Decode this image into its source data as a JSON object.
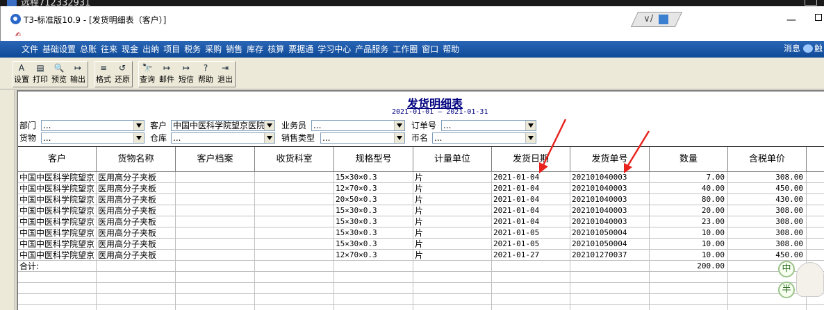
{
  "remote": {
    "title": "远程712332931"
  },
  "window": {
    "title": "T3-标准版10.9 - [发货明细表（客户）]",
    "minimize": "—"
  },
  "menubar": {
    "items": [
      "文件",
      "基础设置",
      "总账",
      "往来",
      "现金",
      "出纳",
      "项目",
      "税务",
      "采购",
      "销售",
      "库存",
      "核算",
      "票据通",
      "学习中心",
      "产品服务",
      "工作圈",
      "窗口",
      "帮助"
    ],
    "news": "消息",
    "news_more": "触"
  },
  "toolbar": {
    "buttons": [
      {
        "label": "设置",
        "icon": "A"
      },
      {
        "label": "打印",
        "icon": "▤"
      },
      {
        "label": "预览",
        "icon": "🔍"
      },
      {
        "label": "输出",
        "icon": "↦"
      },
      {
        "label": "格式",
        "icon": "≡"
      },
      {
        "label": "还原",
        "icon": "↺"
      },
      {
        "label": "查询",
        "icon": "🔭"
      },
      {
        "label": "邮件",
        "icon": "↦"
      },
      {
        "label": "短信",
        "icon": "↦"
      },
      {
        "label": "帮助",
        "icon": "?"
      },
      {
        "label": "退出",
        "icon": "⇥"
      }
    ]
  },
  "report": {
    "title": "发货明细表",
    "date_range": "2021-01-01 — 2021-01-31",
    "filters": {
      "dept": {
        "label": "部门",
        "value": "..."
      },
      "customer": {
        "label": "客户",
        "value": "中国中医科学院望京医院"
      },
      "salesman": {
        "label": "业务员",
        "value": "..."
      },
      "order_no": {
        "label": "订单号",
        "value": "..."
      },
      "goods": {
        "label": "货物",
        "value": "..."
      },
      "warehouse": {
        "label": "仓库",
        "value": "..."
      },
      "sales_type": {
        "label": "销售类型",
        "value": "..."
      },
      "currency": {
        "label": "币名",
        "value": "..."
      }
    },
    "columns": [
      "客户",
      "货物名称",
      "客户档案",
      "收货科室",
      "规格型号",
      "计量单位",
      "发货日期",
      "发货单号",
      "数量",
      "含税单价"
    ],
    "rows": [
      {
        "customer": "中国中医科学院望京",
        "goods": "医用高分子夹板",
        "profile": "",
        "dept": "",
        "spec": "15×30×0.3",
        "unit": "片",
        "date": "2021-01-04",
        "no": "202101040003",
        "qty": "7.00",
        "price": "308.00"
      },
      {
        "customer": "中国中医科学院望京",
        "goods": "医用高分子夹板",
        "profile": "",
        "dept": "",
        "spec": "12×70×0.3",
        "unit": "片",
        "date": "2021-01-04",
        "no": "202101040003",
        "qty": "40.00",
        "price": "450.00"
      },
      {
        "customer": "中国中医科学院望京",
        "goods": "医用高分子夹板",
        "profile": "",
        "dept": "",
        "spec": "20×50×0.3",
        "unit": "片",
        "date": "2021-01-04",
        "no": "202101040003",
        "qty": "80.00",
        "price": "430.00"
      },
      {
        "customer": "中国中医科学院望京",
        "goods": "医用高分子夹板",
        "profile": "",
        "dept": "",
        "spec": "15×30×0.3",
        "unit": "片",
        "date": "2021-01-04",
        "no": "202101040003",
        "qty": "20.00",
        "price": "308.00"
      },
      {
        "customer": "中国中医科学院望京",
        "goods": "医用高分子夹板",
        "profile": "",
        "dept": "",
        "spec": "15×30×0.3",
        "unit": "片",
        "date": "2021-01-04",
        "no": "202101040003",
        "qty": "23.00",
        "price": "308.00"
      },
      {
        "customer": "中国中医科学院望京",
        "goods": "医用高分子夹板",
        "profile": "",
        "dept": "",
        "spec": "15×30×0.3",
        "unit": "片",
        "date": "2021-01-05",
        "no": "202101050004",
        "qty": "10.00",
        "price": "308.00"
      },
      {
        "customer": "中国中医科学院望京",
        "goods": "医用高分子夹板",
        "profile": "",
        "dept": "",
        "spec": "15×30×0.3",
        "unit": "片",
        "date": "2021-01-05",
        "no": "202101050004",
        "qty": "10.00",
        "price": "308.00"
      },
      {
        "customer": "中国中医科学院望京",
        "goods": "医用高分子夹板",
        "profile": "",
        "dept": "",
        "spec": "12×70×0.3",
        "unit": "片",
        "date": "2021-01-27",
        "no": "202101270037",
        "qty": "10.00",
        "price": "450.00"
      }
    ],
    "total": {
      "label": "合计:",
      "qty": "200.00"
    }
  },
  "mascot": {
    "chars": [
      "中",
      "半"
    ]
  },
  "colors": {
    "menubar": "#1656a8",
    "title_blue": "#000080",
    "arrow": "#e8231e"
  }
}
